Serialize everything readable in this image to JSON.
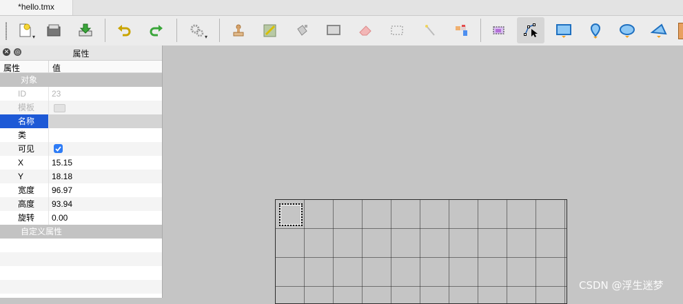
{
  "tabs": [
    {
      "label": "*hello.tmx"
    }
  ],
  "toolbar": {
    "buttons": [
      {
        "name": "new-map",
        "icon": "new-file-icon"
      },
      {
        "name": "open",
        "icon": "folder-icon"
      },
      {
        "name": "save",
        "icon": "save-icon"
      },
      {
        "name": "undo",
        "icon": "undo-icon"
      },
      {
        "name": "redo",
        "icon": "redo-icon"
      },
      {
        "name": "commands",
        "icon": "gears-icon"
      },
      {
        "name": "stamp-brush",
        "icon": "stamp-icon"
      },
      {
        "name": "terrain-brush",
        "icon": "terrain-icon"
      },
      {
        "name": "bucket-fill",
        "icon": "bucket-icon"
      },
      {
        "name": "shape-fill",
        "icon": "rectangle-fill-icon"
      },
      {
        "name": "eraser",
        "icon": "eraser-icon"
      },
      {
        "name": "rect-select",
        "icon": "rect-select-icon"
      },
      {
        "name": "magic-wand",
        "icon": "magic-wand-icon"
      },
      {
        "name": "select-same-tile",
        "icon": "same-tile-icon"
      },
      {
        "name": "select-objects",
        "icon": "select-objects-icon"
      },
      {
        "name": "edit-polygons",
        "icon": "edit-polygons-icon"
      },
      {
        "name": "insert-rectangle",
        "icon": "rectangle-icon"
      },
      {
        "name": "insert-point",
        "icon": "point-icon"
      },
      {
        "name": "insert-ellipse",
        "icon": "ellipse-icon"
      },
      {
        "name": "insert-polygon",
        "icon": "polygon-icon"
      }
    ]
  },
  "properties": {
    "title": "属性",
    "header": {
      "name_col": "属性",
      "value_col": "值"
    },
    "group_object": "对象",
    "rows": [
      {
        "key": "ID",
        "value": "23"
      },
      {
        "key": "模板",
        "value": ""
      },
      {
        "key": "名称",
        "value": ""
      },
      {
        "key": "类",
        "value": ""
      },
      {
        "key": "可见",
        "value": ""
      },
      {
        "key": "X",
        "value": "15.15"
      },
      {
        "key": "Y",
        "value": "18.18"
      },
      {
        "key": "宽度",
        "value": "96.97"
      },
      {
        "key": "高度",
        "value": "93.94"
      },
      {
        "key": "旋转",
        "value": "0.00"
      }
    ],
    "group_custom": "自定义属性"
  },
  "watermark": "CSDN @浮生迷梦",
  "colors": {
    "selection": "#1d59d6",
    "checkbox": "#2e7cf6",
    "canvas_bg": "#c5c5c5"
  }
}
